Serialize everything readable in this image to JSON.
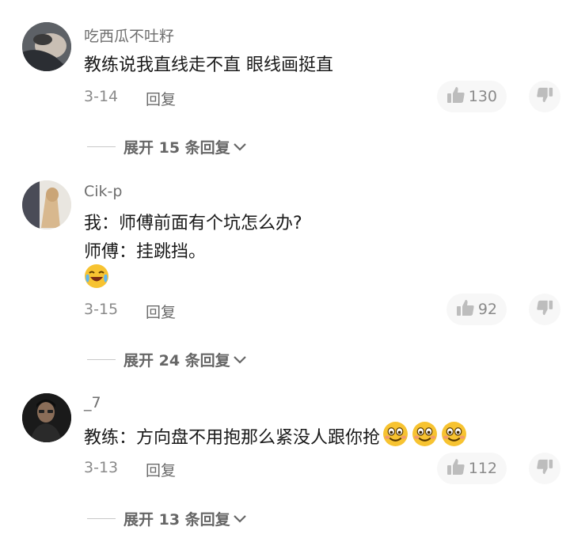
{
  "comments": [
    {
      "username": "吃西瓜不吐籽",
      "lines": [
        "教练说我直线走不直 眼线画挺直"
      ],
      "date": "3-14",
      "reply_label": "回复",
      "likes": "130",
      "expand_label": "展开 15 条回复"
    },
    {
      "username": "Cik-p",
      "lines": [
        "我：师傅前面有个坑怎么办?",
        "师傅：挂跳挡。"
      ],
      "date": "3-15",
      "reply_label": "回复",
      "likes": "92",
      "expand_label": "展开 24 条回复"
    },
    {
      "username": "_7",
      "lines": [
        "教练：方向盘不用抱那么紧没人跟你抢"
      ],
      "date": "3-13",
      "reply_label": "回复",
      "likes": "112",
      "expand_label": "展开 13 条回复"
    }
  ],
  "icons": {
    "like": "thumbs-up-icon",
    "dislike": "thumbs-down-icon",
    "expand": "chevron-down-icon",
    "emoji_cry": "crying-laughing-emoji",
    "emoji_smile": "smile-emoji"
  },
  "colors": {
    "username": "#6e6e6e",
    "meta": "#8a8a8a",
    "pill": "#f7f7f7"
  }
}
